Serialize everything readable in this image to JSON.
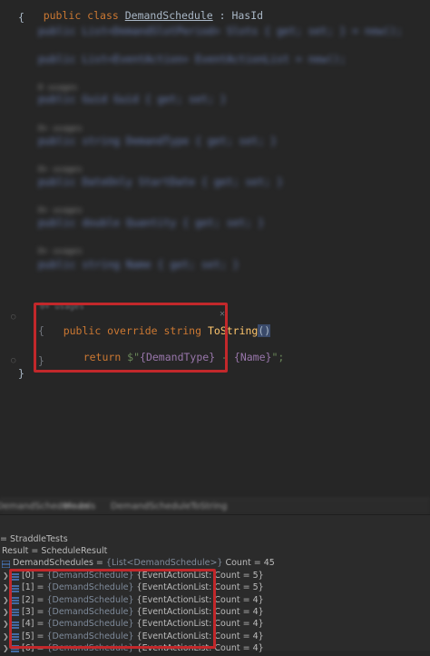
{
  "code": {
    "class_line": {
      "kw": "public class",
      "name": "DemandSchedule",
      "sep": " : ",
      "base": "HasId"
    },
    "open_brace": "{",
    "blurred_lines": [
      "public List<DemandSlotPeriod> Slots { get; set; } = new();",
      "public List<EventAction> EventActionList = new();",
      "public Guid Guid { get; set; }",
      "public string DemandType { get; set; }",
      "public DateOnly StartDate { get; set; }",
      "public double Quantity { get; set; }",
      "public string Name { get; set; }"
    ],
    "blurred_usages": [
      "0 usages",
      "0+ usages",
      "0+ usages",
      "0+ usages",
      "0+ usages"
    ],
    "method_usage": "0+ usages",
    "method_signature": {
      "kw": "public override string",
      "name": "ToString",
      "parens": "()"
    },
    "method_open": "{",
    "return_line": {
      "kw": "return",
      "prefix": " $\"",
      "interp1": "{DemandType}",
      "mid": " - ",
      "interp2": "{Name}",
      "suffix": "\";"
    },
    "method_close": "}",
    "class_close": "}"
  },
  "breadcrumb": [
    "DemandSchedule.cs",
    "Models",
    "DemandSchedule",
    "ToString"
  ],
  "debugger": {
    "context_label": "= StraddleTests",
    "result_line": "Result = ScheduleResult",
    "schedules_line": {
      "name": "DemandSchedules",
      "eq": " = ",
      "type": "{List<DemandSchedule>}",
      "count": " Count = 45"
    },
    "items": [
      {
        "index": "[0]",
        "type": "{DemandSchedule}",
        "field": "{EventActionList: Count = 5}"
      },
      {
        "index": "[1]",
        "type": "{DemandSchedule}",
        "field": "{EventActionList: Count = 5}"
      },
      {
        "index": "[2]",
        "type": "{DemandSchedule}",
        "field": "{EventActionList: Count = 4}"
      },
      {
        "index": "[3]",
        "type": "{DemandSchedule}",
        "field": "{EventActionList: Count = 4}"
      },
      {
        "index": "[4]",
        "type": "{DemandSchedule}",
        "field": "{EventActionList: Count = 4}"
      },
      {
        "index": "[5]",
        "type": "{DemandSchedule}",
        "field": "{EventActionList: Count = 4}"
      },
      {
        "index": "[6]",
        "type": "{DemandSchedule}",
        "field": "{EventActionList: Count = 4}"
      }
    ]
  },
  "colors": {
    "highlight": "#c2282b",
    "list_icon": "#4e86d6"
  }
}
